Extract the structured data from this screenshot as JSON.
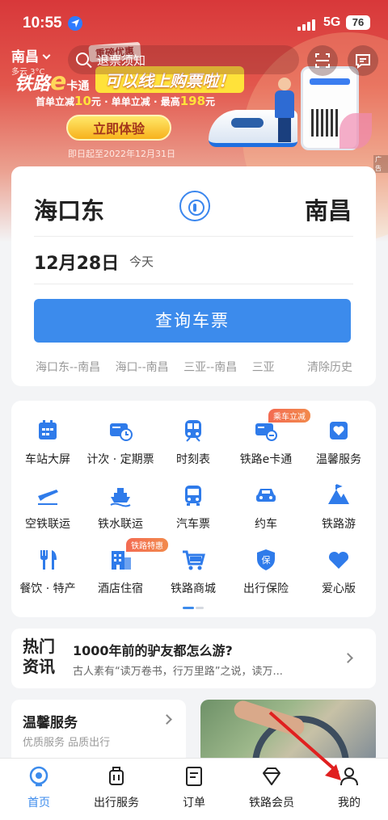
{
  "status": {
    "time": "10:55",
    "network": "5G",
    "battery": "76"
  },
  "header": {
    "city": "南昌",
    "weather": "多云 3°C",
    "search_placeholder": "退票须知"
  },
  "banner": {
    "tag": "重磅优惠",
    "brand": "铁路",
    "brand_e": "e",
    "brand_suffix": "卡通",
    "title": "可以线上购票啦！",
    "sub_a": "首单立减",
    "sub_a_val": "10",
    "sub_b": "元 · 单单立减 · 最高",
    "sub_b_val": "198",
    "sub_c": "元",
    "cta": "立即体验",
    "date": "即日起至2022年12月31日",
    "ad": "广告"
  },
  "ticket": {
    "from": "海口东",
    "to": "南昌",
    "date": "12月28日",
    "weekday": "今天",
    "query": "查询车票",
    "history": [
      "海口东--南昌",
      "海口--南昌",
      "三亚--南昌",
      "三亚"
    ],
    "clear": "清除历史"
  },
  "services": [
    {
      "label": "车站大屏",
      "icon": "station-screen-icon"
    },
    {
      "label": "计次 · 定期票",
      "icon": "season-ticket-icon"
    },
    {
      "label": "时刻表",
      "icon": "timetable-icon"
    },
    {
      "label": "铁路e卡通",
      "icon": "ecard-icon",
      "badge": "乘车立减"
    },
    {
      "label": "温馨服务",
      "icon": "warm-service-icon"
    },
    {
      "label": "空铁联运",
      "icon": "air-rail-icon"
    },
    {
      "label": "铁水联运",
      "icon": "ship-rail-icon"
    },
    {
      "label": "汽车票",
      "icon": "bus-icon"
    },
    {
      "label": "约车",
      "icon": "car-icon"
    },
    {
      "label": "铁路游",
      "icon": "travel-icon"
    },
    {
      "label": "餐饮 · 特产",
      "icon": "dining-icon"
    },
    {
      "label": "酒店住宿",
      "icon": "hotel-icon",
      "badge": "铁路特惠"
    },
    {
      "label": "铁路商城",
      "icon": "mall-icon"
    },
    {
      "label": "出行保险",
      "icon": "insurance-icon"
    },
    {
      "label": "爱心版",
      "icon": "heart-icon"
    }
  ],
  "news": {
    "tag": "热门资讯",
    "title": "1000年前的驴友都怎么游?",
    "desc": "古人素有“读万卷书，行万里路”之说，读万..."
  },
  "warm": {
    "title": "温馨服务",
    "sub": "优质服务 品质出行"
  },
  "tabs": [
    {
      "label": "首页",
      "active": true
    },
    {
      "label": "出行服务"
    },
    {
      "label": "订单"
    },
    {
      "label": "铁路会员"
    },
    {
      "label": "我的"
    }
  ],
  "colors": {
    "accent": "#3c8bec",
    "banner_red": "#d8383a",
    "badge": "#f36b52"
  }
}
